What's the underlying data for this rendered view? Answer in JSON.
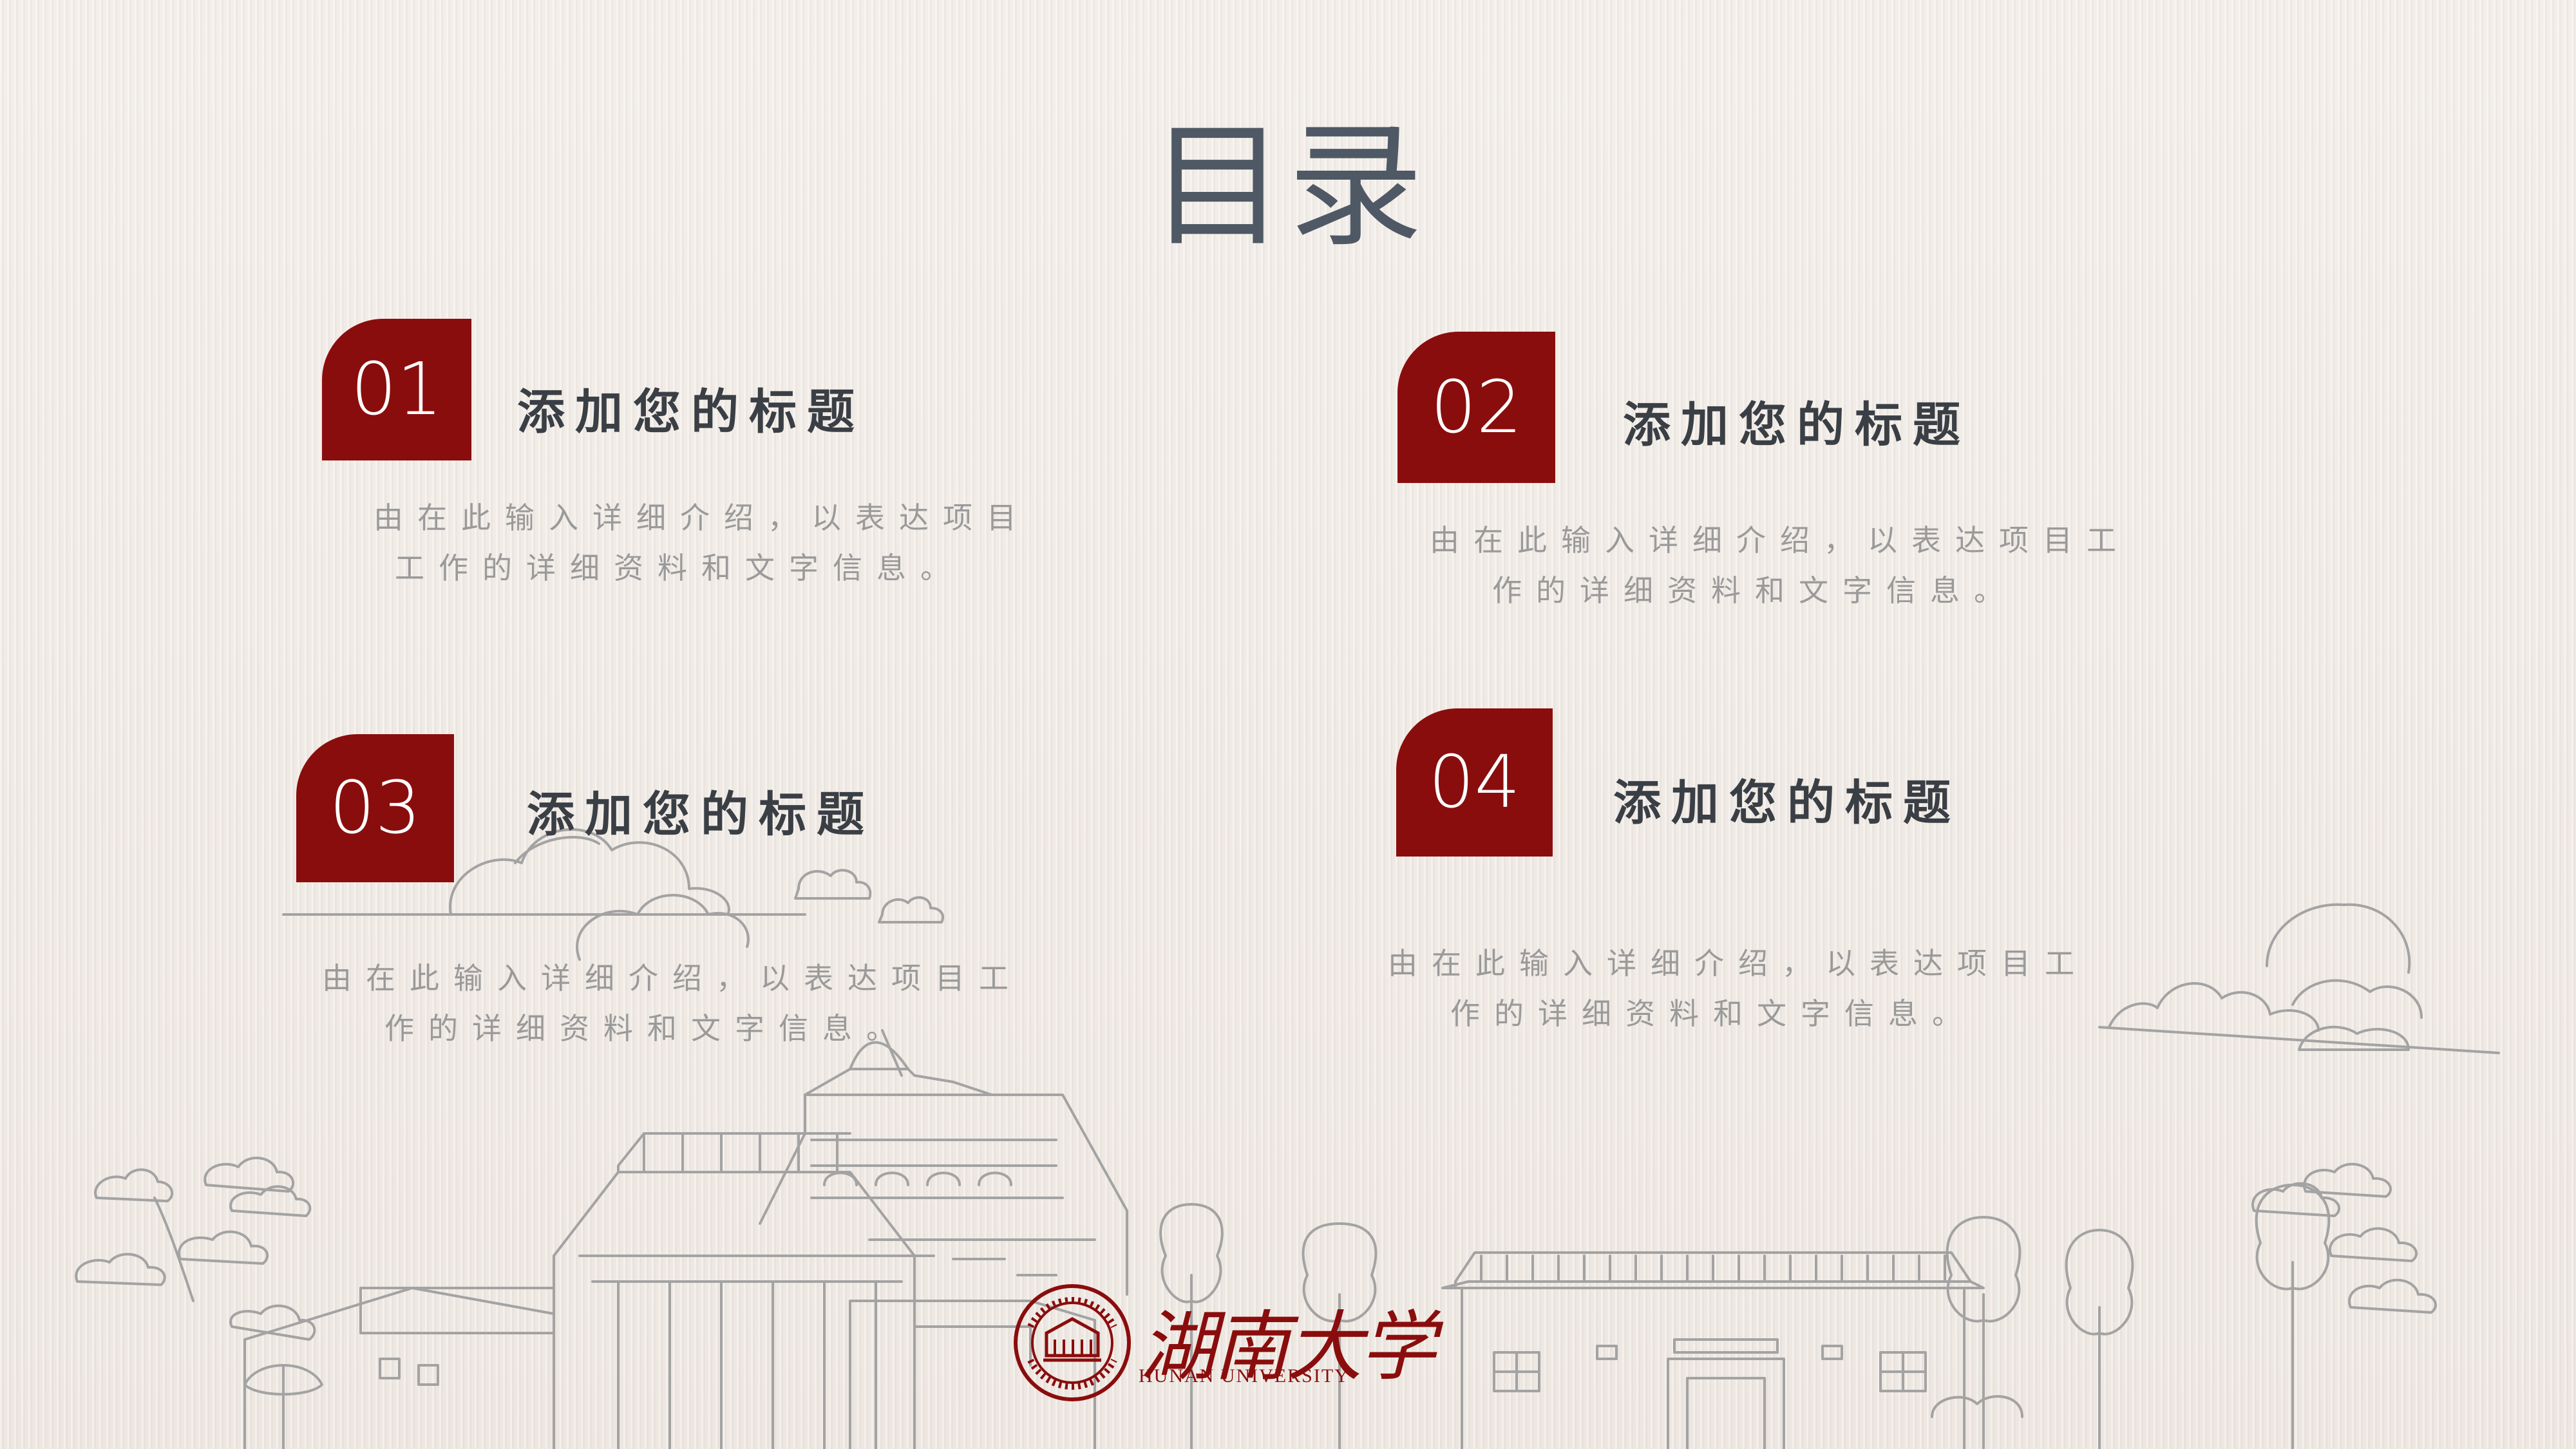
{
  "page": {
    "title": "目录"
  },
  "items": [
    {
      "number": "01",
      "heading": "添加您的标题",
      "desc_line1": "由在此输入详细介绍，以表达项目",
      "desc_line2": "工作的详细资料和文字信息。"
    },
    {
      "number": "02",
      "heading": "添加您的标题",
      "desc_line1": "由在此输入详细介绍，以表达项目工",
      "desc_line2": "作的详细资料和文字信息。"
    },
    {
      "number": "03",
      "heading": "添加您的标题",
      "desc_line1": "由在此输入详细介绍，以表达项目工",
      "desc_line2": "作的详细资料和文字信息。"
    },
    {
      "number": "04",
      "heading": "添加您的标题",
      "desc_line1": "由在此输入详细介绍，以表达项目工",
      "desc_line2": "作的详细资料和文字信息。"
    }
  ],
  "logo": {
    "name_cn": "湖南大学",
    "name_en": "HUNAN UNIVERSITY"
  },
  "colors": {
    "accent": "#8a0d0d",
    "title": "#4f5965",
    "heading": "#3a3f45",
    "body": "#9a9a9a",
    "background": "#f1ebe6",
    "line_art": "#9e9e9e"
  }
}
